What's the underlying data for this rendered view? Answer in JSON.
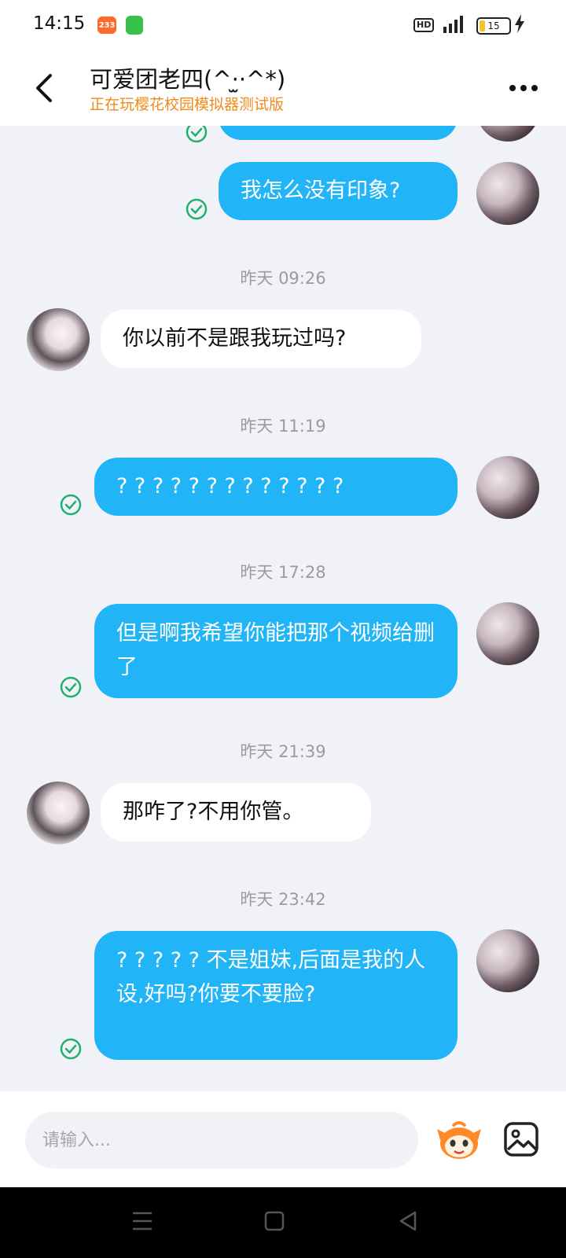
{
  "status_bar": {
    "time": "14:15",
    "app_badge": "233",
    "network_badge": "HD",
    "signal": "4G",
    "battery": "15"
  },
  "header": {
    "title": "可爱团老四(^·̫·^*)",
    "subtitle": "正在玩樱花校园模拟器测试版",
    "back_icon": "chevron-left-icon",
    "more_icon": "more-dots-icon"
  },
  "messages": [
    {
      "side": "out",
      "text": "我怎么没有印象?",
      "status": "read"
    },
    {
      "timestamp": "昨天 09:26"
    },
    {
      "side": "in",
      "text": "你以前不是跟我玩过吗?"
    },
    {
      "timestamp": "昨天 11:19"
    },
    {
      "side": "out",
      "text": "? ? ? ? ? ? ? ? ? ? ? ? ?",
      "status": "read"
    },
    {
      "timestamp": "昨天 17:28"
    },
    {
      "side": "out",
      "text": "但是啊我希望你能把那个视频给删了",
      "status": "read"
    },
    {
      "timestamp": "昨天 21:39"
    },
    {
      "side": "in",
      "text": "那咋了?不用你管。"
    },
    {
      "timestamp": "昨天 23:42"
    },
    {
      "side": "out",
      "text": "? ? ? ? ? 不是姐妹,后面是我的人设,好吗?你要不要脸?",
      "status": "read"
    }
  ],
  "input": {
    "placeholder": "请输入...",
    "emoji_icon": "emoji-mascot-icon",
    "image_icon": "image-picker-icon"
  },
  "nav": {
    "recents_icon": "menu-lines-icon",
    "home_icon": "square-home-icon",
    "back_icon": "triangle-back-icon"
  },
  "colors": {
    "outgoing_bubble": "#21b4f6",
    "incoming_bubble": "#ffffff",
    "subtitle": "#f08a1c",
    "read_check": "#20b070",
    "chat_background": "#f1f2f7"
  }
}
